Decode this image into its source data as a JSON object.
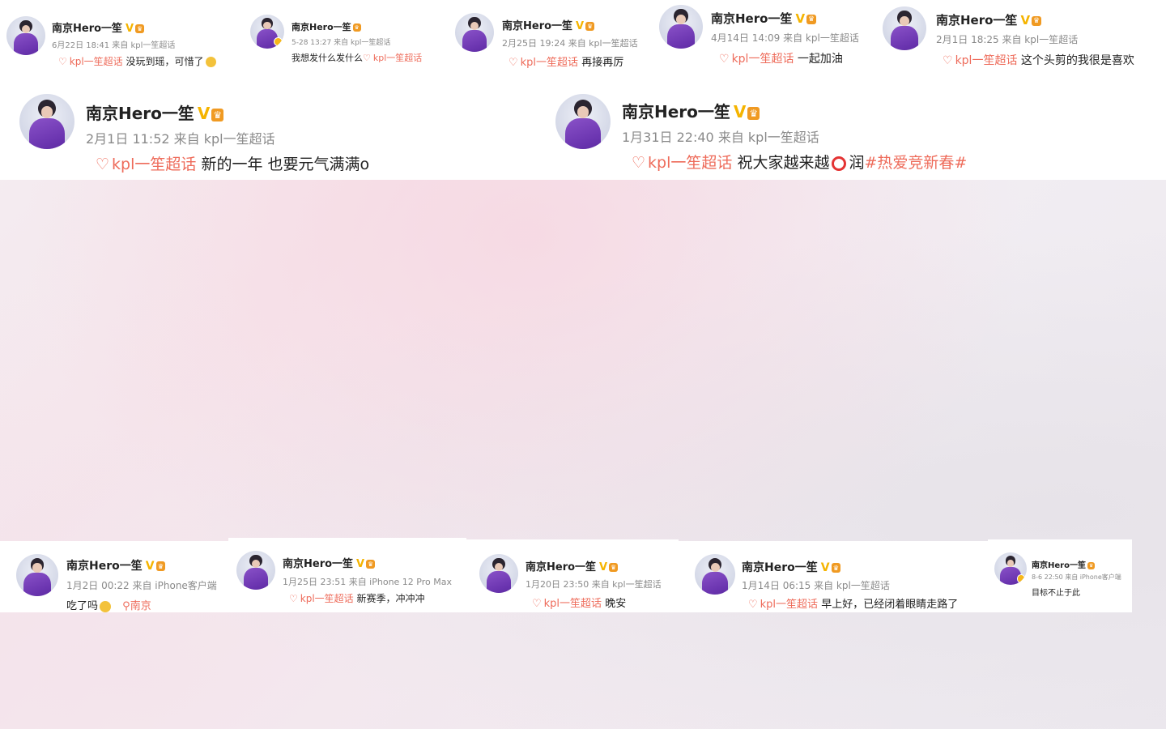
{
  "author": "南京Hero一笙",
  "verified_mark": "V",
  "crown_label": "♛",
  "topic_icon": "♡",
  "row1": [
    {
      "time": "6月22日 18:41 来自 kpl一笙超话",
      "topic": "kpl一笙超话",
      "text": "没玩到瑶，可惜了"
    },
    {
      "time": "5-28 13:27 来自 kpl一笙超话",
      "text": "我想发什么发什么",
      "topic": "kpl一笙超话"
    },
    {
      "time": "2月25日 19:24 来自 kpl一笙超话",
      "topic": "kpl一笙超话",
      "text": "再接再厉"
    },
    {
      "time": "4月14日 14:09 来自 kpl一笙超话",
      "topic": "kpl一笙超话",
      "text": "一起加油"
    },
    {
      "time": "2月1日 18:25 来自 kpl一笙超话",
      "topic": "kpl一笙超话",
      "text": "这个头剪的我很是喜欢"
    }
  ],
  "row2": [
    {
      "time": "2月1日 11:52 来自 kpl一笙超话",
      "topic": "kpl一笙超话",
      "text": "新的一年 也要元气满满o"
    },
    {
      "time": "1月31日 22:40 来自 kpl一笙超话",
      "topic": "kpl一笙超话",
      "text": "祝大家越来越",
      "text2": "润",
      "hashtag": "#热爱竞新春#"
    }
  ],
  "row3": [
    {
      "time": "1月2日 00:22 来自 iPhone客户端",
      "text": "吃了吗",
      "location": "南京"
    },
    {
      "time": "1月25日 23:51 来自 iPhone 12 Pro Max",
      "topic": "kpl一笙超话",
      "text": "新赛季，冲冲冲"
    },
    {
      "time": "1月20日 23:50 来自 kpl一笙超话",
      "topic": "kpl一笙超话",
      "text": "晚安"
    },
    {
      "time": "1月14日 06:15 来自 kpl一笙超话",
      "topic": "kpl一笙超话",
      "text": "早上好，已经闭着眼睛走路了"
    },
    {
      "time": "8-6 22:50 来自 iPhone客户端",
      "text": "目标不止于此"
    }
  ]
}
